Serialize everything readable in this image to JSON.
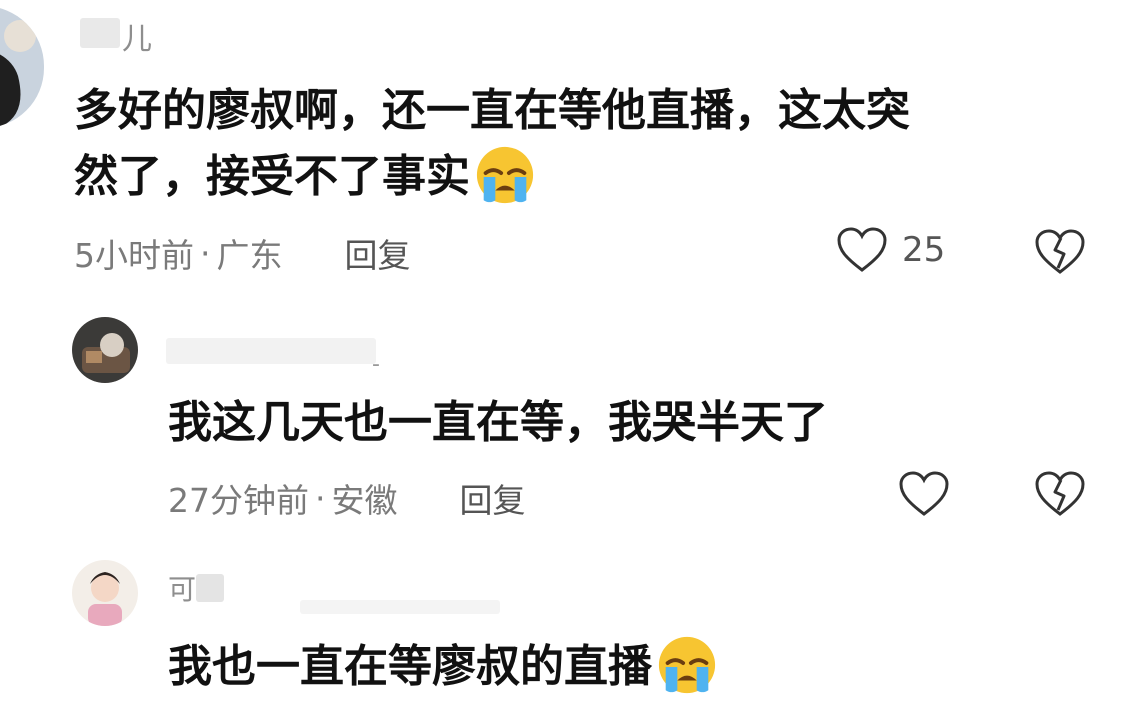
{
  "comments": [
    {
      "username": "儿",
      "text_line1": "多好的廖叔啊，还一直在等他直播，这太突",
      "text_line2": "然了，接受不了事实",
      "time": "5小时前",
      "location": "广东",
      "reply": "回复",
      "likes": "25"
    },
    {
      "username": "-",
      "text": "我这几天也一直在等，我哭半天了",
      "time": "27分钟前",
      "location": "安徽",
      "reply": "回复"
    },
    {
      "username": "可",
      "text": "我也一直在等廖叔的直播"
    }
  ],
  "meta_separator": "·",
  "icons": {
    "emoji": "crying-face-icon",
    "like": "heart-outline-icon",
    "dislike": "broken-heart-icon"
  }
}
